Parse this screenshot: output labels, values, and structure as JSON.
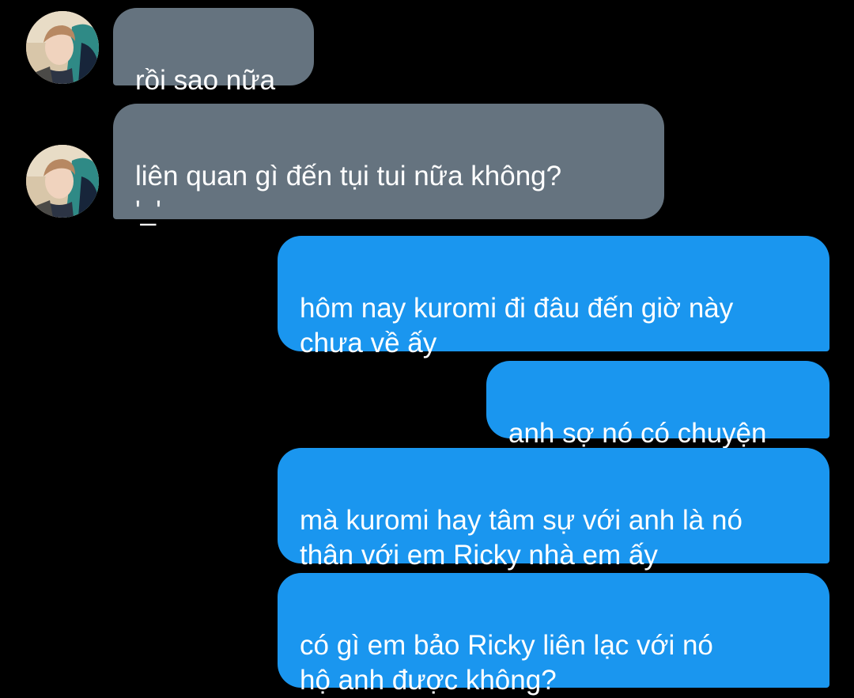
{
  "colors": {
    "background": "#000000",
    "incoming_bubble": "#65737f",
    "outgoing_bubble": "#1a96ef",
    "text": "#ffffff"
  },
  "messages": [
    {
      "direction": "incoming",
      "sender_avatar": "user-avatar-photo",
      "text": "rồi sao nữa"
    },
    {
      "direction": "incoming",
      "sender_avatar": "user-avatar-photo",
      "text": "liên quan gì đến tụi tui nữa không?\n'_'"
    },
    {
      "direction": "outgoing",
      "text": "hôm nay kuromi đi đâu đến giờ này\nchưa về ấy"
    },
    {
      "direction": "outgoing",
      "text": "anh sợ nó có chuyện"
    },
    {
      "direction": "outgoing",
      "text": "mà kuromi hay tâm sự với anh là nó\nthân với em Ricky nhà em ấy"
    },
    {
      "direction": "outgoing",
      "text": "có gì em bảo Ricky liên lạc với nó\nhộ anh được không?"
    }
  ]
}
